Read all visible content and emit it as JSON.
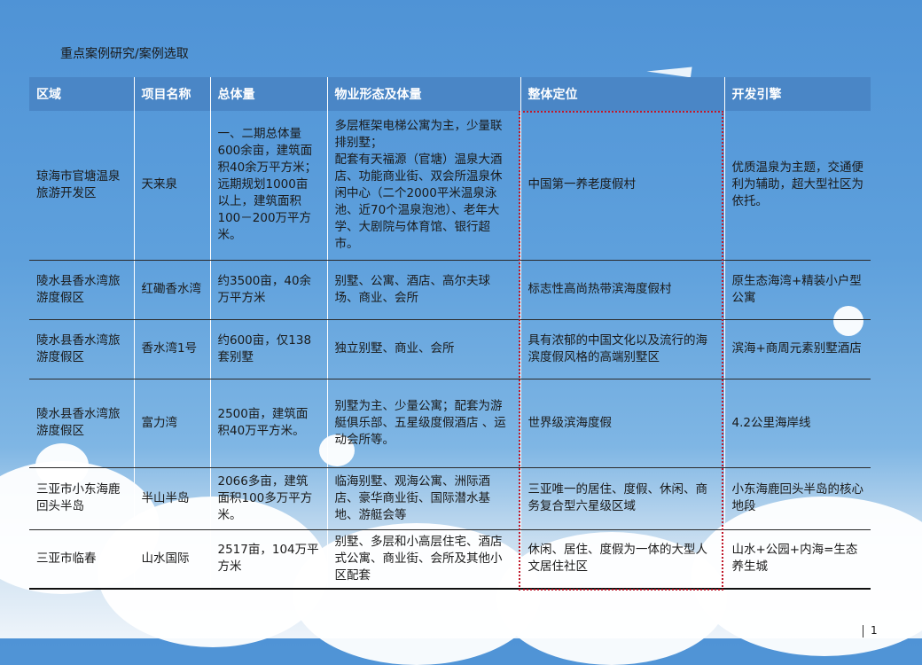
{
  "title": "重点案例研究/案例选取",
  "headers": [
    "区域",
    "项目名称",
    "总体量",
    "物业形态及体量",
    "整体定位",
    "开发引擎"
  ],
  "rows": [
    {
      "area": "琼海市官塘温泉旅游开发区",
      "project": "天来泉",
      "volume": "一、二期总体量600余亩，建筑面积40余万平方米；\n远期规划1000亩以上，建筑面积100－200万平方米。",
      "property": "多层框架电梯公寓为主，少量联排别墅；\n配套有天福源（官塘）温泉大酒店、功能商业街、双会所温泉休闲中心（二个2000平米温泉泳池、近70个温泉泡池）、老年大学、大剧院与体育馆、银行超市。",
      "positioning": "中国第一养老度假村",
      "engine": "优质温泉为主题，交通便利为辅助，超大型社区为依托。"
    },
    {
      "area": "陵水县香水湾旅游度假区",
      "project": "红磡香水湾",
      "volume": "约3500亩，40余万平方米",
      "property": "别墅、公寓、酒店、高尔夫球场、商业、会所",
      "positioning": "标志性高尚热带滨海度假村",
      "engine": "原生态海湾+精装小户型公寓"
    },
    {
      "area": "陵水县香水湾旅游度假区",
      "project": "香水湾1号",
      "volume": "约600亩，仅138套别墅",
      "property": "独立别墅、商业、会所",
      "positioning": "具有浓郁的中国文化以及流行的海滨度假风格的高端别墅区",
      "engine": "滨海+商周元素别墅酒店"
    },
    {
      "area": "陵水县香水湾旅游度假区",
      "project": "富力湾",
      "volume": "2500亩，建筑面积40万平方米。",
      "property": "别墅为主、少量公寓；配套为游艇俱乐部、五星级度假酒店 、运动会所等。",
      "positioning": "世界级滨海度假",
      "engine": "4.2公里海岸线"
    },
    {
      "area": "三亚市小东海鹿回头半岛",
      "project": "半山半岛",
      "volume": "2066多亩，建筑面积100多万平方米。",
      "property": "临海别墅、观海公寓、洲际酒店、豪华商业街、国际潜水基地、游艇会等",
      "positioning": "三亚唯一的居住、度假、休闲、商务复合型六星级区域",
      "engine": "小东海鹿回头半岛的核心地段"
    },
    {
      "area": "三亚市临春",
      "project": "山水国际",
      "volume": "2517亩，104万平方米",
      "property": "别墅、多层和小高层住宅、酒店式公寓、商业街、会所及其他小区配套",
      "positioning": "休闲、居住、度假为一体的大型人文居住社区",
      "engine": "山水+公园+内海=生态养生城"
    }
  ],
  "page_number": "1"
}
